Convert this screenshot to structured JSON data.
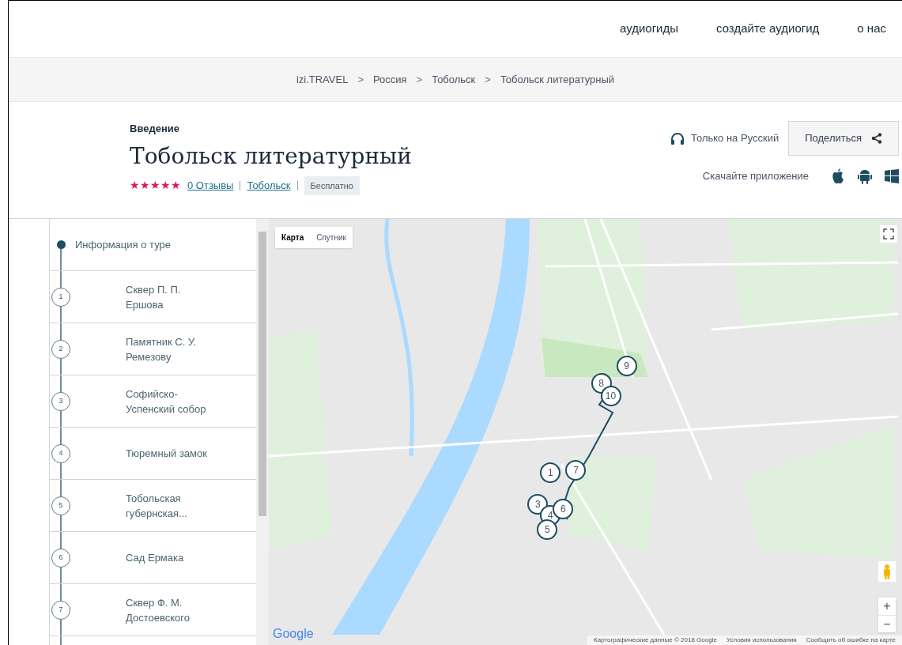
{
  "nav": [
    "аудиогиды",
    "создайте аудиогид",
    "о нас"
  ],
  "breadcrumbs": [
    "izi.TRAVEL",
    "Россия",
    "Тобольск",
    "Тобольск литературный"
  ],
  "breadcrumb_separator": ">",
  "header": {
    "kicker": "Введение",
    "title": "Тобольск литературный",
    "stars": 5,
    "reviews": "0 Отзывы",
    "city": "Тобольск",
    "price": "Бесплатно",
    "language": "Только на Русский",
    "share": "Поделиться",
    "download": "Скачайте приложение"
  },
  "tour_list": [
    {
      "kind": "info",
      "label": "Информация о туре"
    },
    {
      "kind": "stop",
      "number": "1",
      "label": "Сквер П. П. Ершова"
    },
    {
      "kind": "stop",
      "number": "2",
      "label": "Памятник С. У. Ремезову"
    },
    {
      "kind": "stop",
      "number": "3",
      "label": "Софийско-Успенский собор"
    },
    {
      "kind": "stop",
      "number": "4",
      "label": "Тюремный замок"
    },
    {
      "kind": "stop",
      "number": "5",
      "label": "Тобольская губернская..."
    },
    {
      "kind": "stop",
      "number": "6",
      "label": "Сад Ермака"
    },
    {
      "kind": "stop",
      "number": "7",
      "label": "Сквер Ф. М. Достоевского"
    }
  ],
  "map": {
    "types": [
      {
        "label": "Карта",
        "selected": true
      },
      {
        "label": "Спутник",
        "selected": false
      }
    ],
    "markers": [
      {
        "number": "9"
      },
      {
        "number": "8"
      },
      {
        "number": "10"
      },
      {
        "number": "1"
      },
      {
        "number": "7"
      },
      {
        "number": "3"
      },
      {
        "number": "4"
      },
      {
        "number": "6"
      },
      {
        "number": "5"
      }
    ],
    "zoom_in": "+",
    "zoom_out": "−",
    "google": "Google",
    "attribution": "Картографические данные © 2018 Google",
    "terms": "Условия использования",
    "report": "Сообщить об ошибке на карте"
  }
}
